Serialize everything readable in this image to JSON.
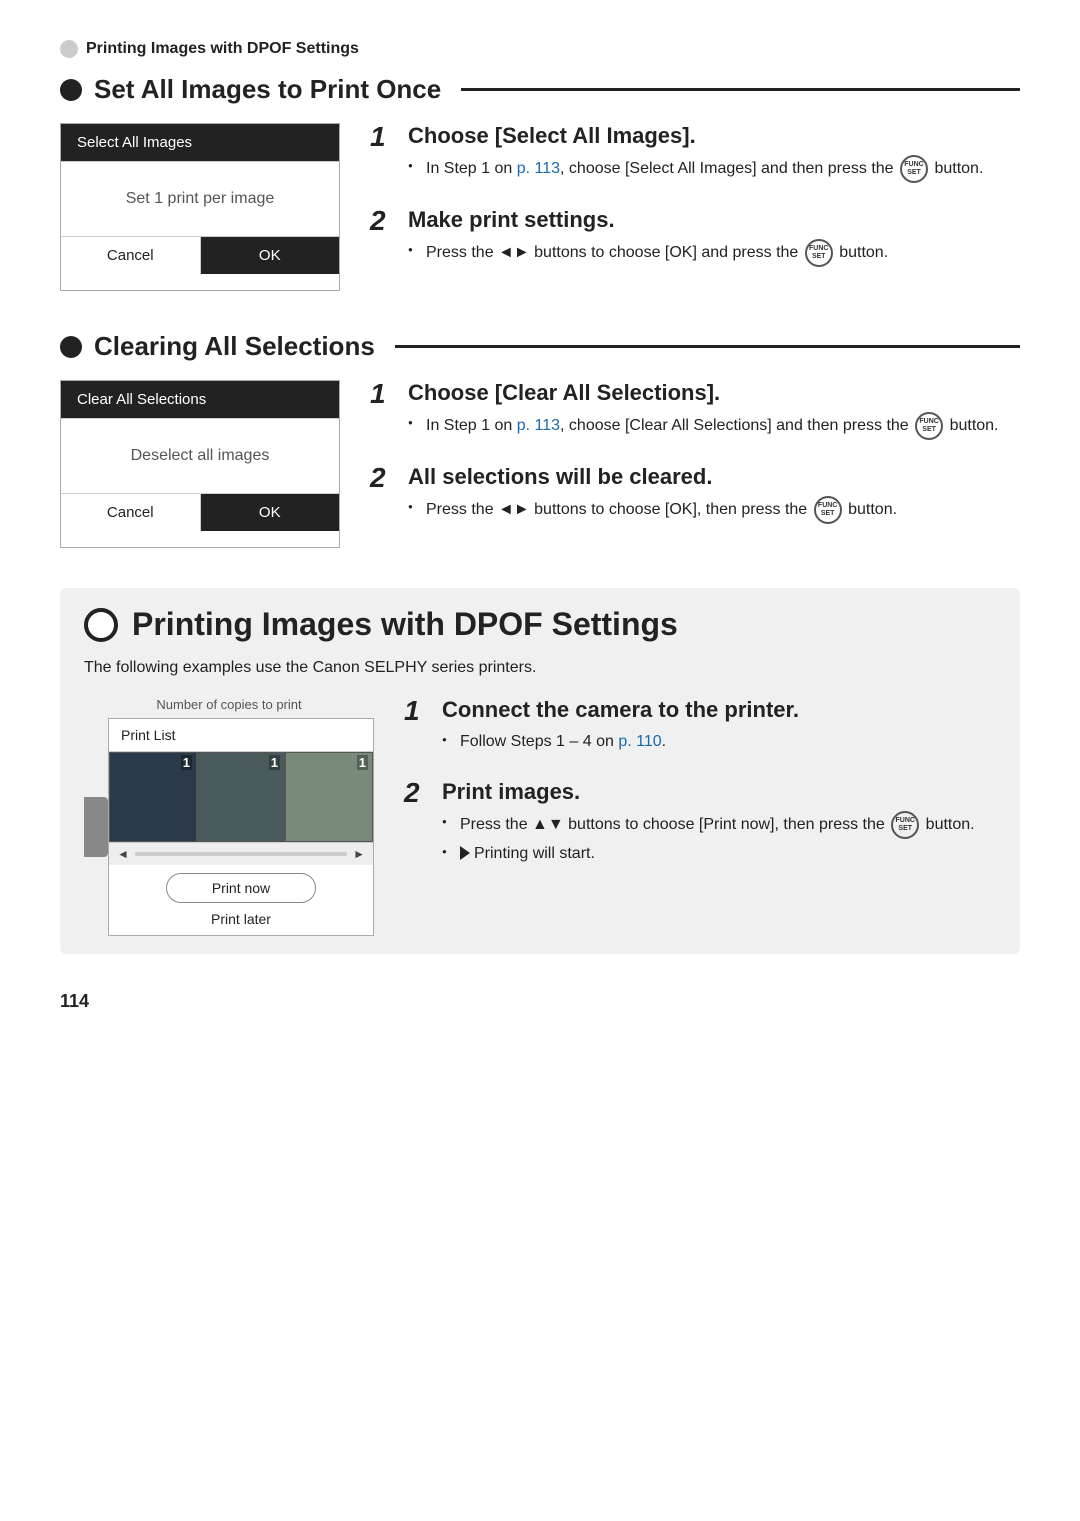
{
  "breadcrumb": {
    "text": "Printing Images with DPOF Settings"
  },
  "section1": {
    "title": "Set All Images to Print Once",
    "screen": {
      "row1": "Select All Images",
      "center": "Set 1 print per image",
      "btn_cancel": "Cancel",
      "btn_ok": "OK"
    },
    "steps": [
      {
        "num": "1",
        "title": "Choose [Select All Images].",
        "bullets": [
          "In Step 1 on p. 113, choose [Select All Images] and then press the  button."
        ]
      },
      {
        "num": "2",
        "title": "Make print settings.",
        "bullets": [
          "Press the ◄► buttons to choose [OK] and press the  button."
        ]
      }
    ]
  },
  "section2": {
    "title": "Clearing All Selections",
    "screen": {
      "row1": "Clear All Selections",
      "center": "Deselect all images",
      "btn_cancel": "Cancel",
      "btn_ok": "OK"
    },
    "steps": [
      {
        "num": "1",
        "title": "Choose [Clear All Selections].",
        "bullets": [
          "In Step 1 on p. 113, choose [Clear All Selections] and then press the  button."
        ]
      },
      {
        "num": "2",
        "title": "All selections will be cleared.",
        "bullets": [
          "Press the ◄► buttons to choose [OK], then press the  button."
        ]
      }
    ]
  },
  "section3": {
    "title": "Printing Images with DPOF Settings",
    "intro": "The following examples use the Canon SELPHY series printers.",
    "copies_label": "Number of copies to print",
    "screen": {
      "title": "Print List",
      "btn_print_now": "Print now",
      "btn_print_later": "Print later"
    },
    "steps": [
      {
        "num": "1",
        "title": "Connect the camera to the printer.",
        "bullets": [
          "Follow Steps 1 – 4 on p. 110."
        ]
      },
      {
        "num": "2",
        "title": "Print images.",
        "bullets": [
          "Press the ▲▼ buttons to choose [Print now], then press the  button.",
          "Printing will start."
        ]
      }
    ]
  },
  "page_number": "114",
  "links": {
    "p113": "p. 113",
    "p110": "p. 110"
  }
}
